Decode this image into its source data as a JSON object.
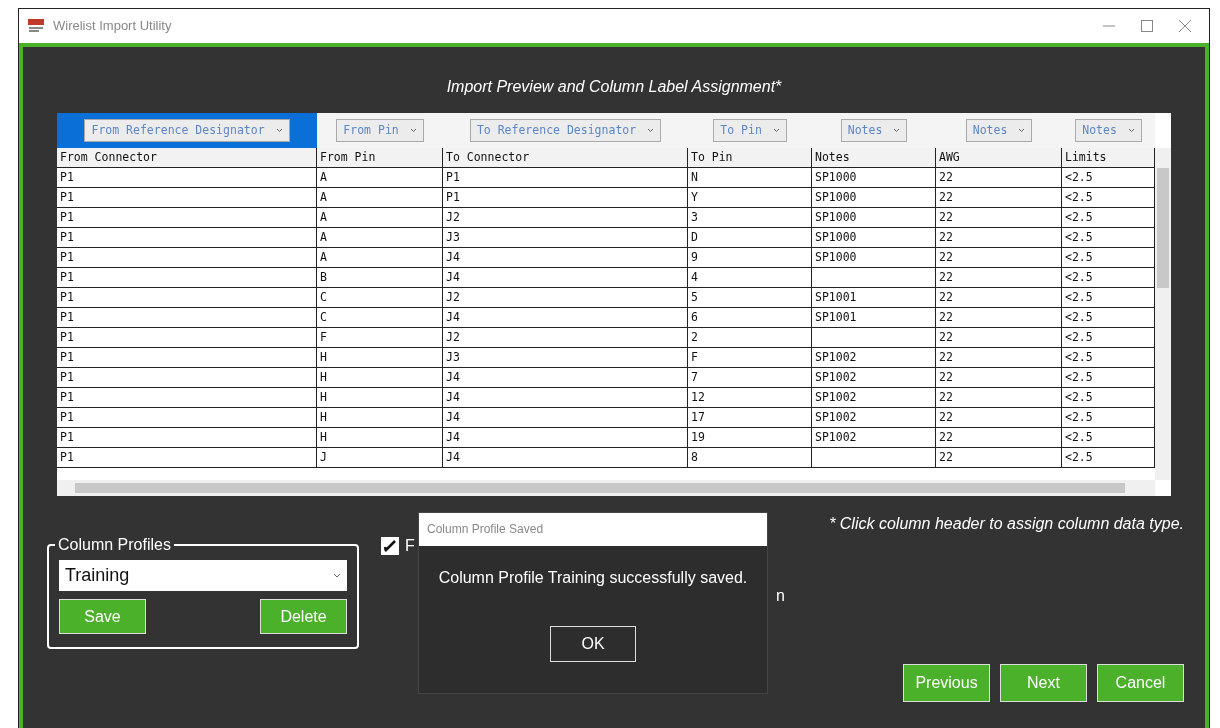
{
  "window": {
    "title": "Wirelist Import Utility"
  },
  "heading": "Import Preview and Column Label Assignment*",
  "type_selectors": [
    {
      "label": "From Reference Designator",
      "selected": true
    },
    {
      "label": "From Pin",
      "selected": false
    },
    {
      "label": "To Reference Designator",
      "selected": false
    },
    {
      "label": "To Pin",
      "selected": false
    },
    {
      "label": "Notes",
      "selected": false
    },
    {
      "label": "Notes",
      "selected": false
    },
    {
      "label": "Notes",
      "selected": false
    }
  ],
  "table": {
    "columns": [
      "From Connector",
      "From Pin",
      "To Connector",
      "To Pin",
      "Notes",
      "AWG",
      "Limits"
    ],
    "rows": [
      [
        "P1",
        "A",
        "P1",
        "N",
        "SP1000",
        "22",
        "<2.5"
      ],
      [
        "P1",
        "A",
        "P1",
        "Y",
        "SP1000",
        "22",
        "<2.5"
      ],
      [
        "P1",
        "A",
        "J2",
        "3",
        "SP1000",
        "22",
        "<2.5"
      ],
      [
        "P1",
        "A",
        "J3",
        "D",
        "SP1000",
        "22",
        "<2.5"
      ],
      [
        "P1",
        "A",
        "J4",
        "9",
        "SP1000",
        "22",
        "<2.5"
      ],
      [
        "P1",
        "B",
        "J4",
        "4",
        null,
        "22",
        "<2.5"
      ],
      [
        "P1",
        "C",
        "J2",
        "5",
        "SP1001",
        "22",
        "<2.5"
      ],
      [
        "P1",
        "C",
        "J4",
        "6",
        "SP1001",
        "22",
        "<2.5"
      ],
      [
        "P1",
        "F",
        "J2",
        "2",
        null,
        "22",
        "<2.5"
      ],
      [
        "P1",
        "H",
        "J3",
        "F",
        "SP1002",
        "22",
        "<2.5"
      ],
      [
        "P1",
        "H",
        "J4",
        "7",
        "SP1002",
        "22",
        "<2.5"
      ],
      [
        "P1",
        "H",
        "J4",
        "12",
        "SP1002",
        "22",
        "<2.5"
      ],
      [
        "P1",
        "H",
        "J4",
        "17",
        "SP1002",
        "22",
        "<2.5"
      ],
      [
        "P1",
        "H",
        "J4",
        "19",
        "SP1002",
        "22",
        "<2.5"
      ],
      [
        "P1",
        "J",
        "J4",
        "8",
        null,
        "22",
        "<2.5"
      ]
    ]
  },
  "column_profiles": {
    "legend": "Column Profiles",
    "value": "Training",
    "buttons": [
      "Save",
      "Delete"
    ]
  },
  "checkbox": {
    "checked": true,
    "label_start": "F",
    "label_end": "n"
  },
  "note": "* Click column header to assign column data type.",
  "nav_buttons": [
    "Previous",
    "Next",
    "Cancel"
  ],
  "dialog": {
    "title": "Column Profile Saved",
    "message": "Column Profile Training successfully saved.",
    "button": "OK"
  }
}
